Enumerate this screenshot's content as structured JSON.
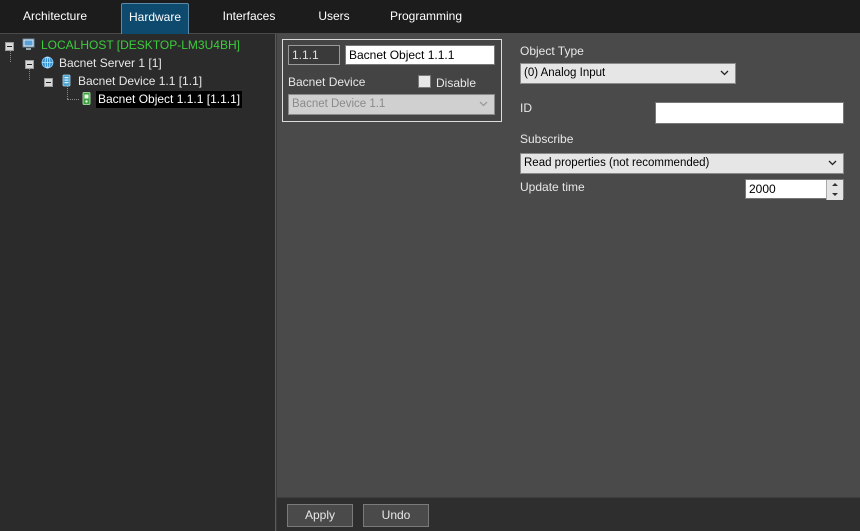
{
  "tabs": [
    {
      "label": "Architecture",
      "active": false
    },
    {
      "label": "Hardware",
      "active": true
    },
    {
      "label": "Interfaces",
      "active": false
    },
    {
      "label": "Users",
      "active": false
    },
    {
      "label": "Programming",
      "active": false
    }
  ],
  "tree": {
    "items": [
      {
        "label": "LOCALHOST [DESKTOP-LM3U4BH]",
        "icon": "computer-icon",
        "level": 0
      },
      {
        "label": "Bacnet Server 1 [1]",
        "icon": "globe-server-icon",
        "level": 1
      },
      {
        "label": "Bacnet Device 1.1 [1.1]",
        "icon": "device-icon",
        "level": 2
      },
      {
        "label": "Bacnet Object 1.1.1 [1.1.1]",
        "icon": "object-icon",
        "level": 3,
        "selected": true
      }
    ]
  },
  "object": {
    "id_value": "1.1.1",
    "name_value": "Bacnet Object 1.1.1",
    "device_label": "Bacnet Device",
    "disable_label": "Disable",
    "disable_checked": false,
    "device_value": "Bacnet Device 1.1"
  },
  "settings": {
    "object_type_label": "Object Type",
    "object_type_value": "(0) Analog Input",
    "id_label": "ID",
    "id_value": "",
    "subscribe_label": "Subscribe",
    "subscribe_value": "Read properties (not recommended)",
    "update_time_label": "Update time",
    "update_time_value": "2000"
  },
  "actions": {
    "apply_label": "Apply",
    "undo_label": "Undo"
  },
  "colors": {
    "active_tab": "#0d4a6e",
    "host_green": "#3ccc3c",
    "panel_bg": "#4a4a4a",
    "tree_bg": "#2b2b2b"
  }
}
